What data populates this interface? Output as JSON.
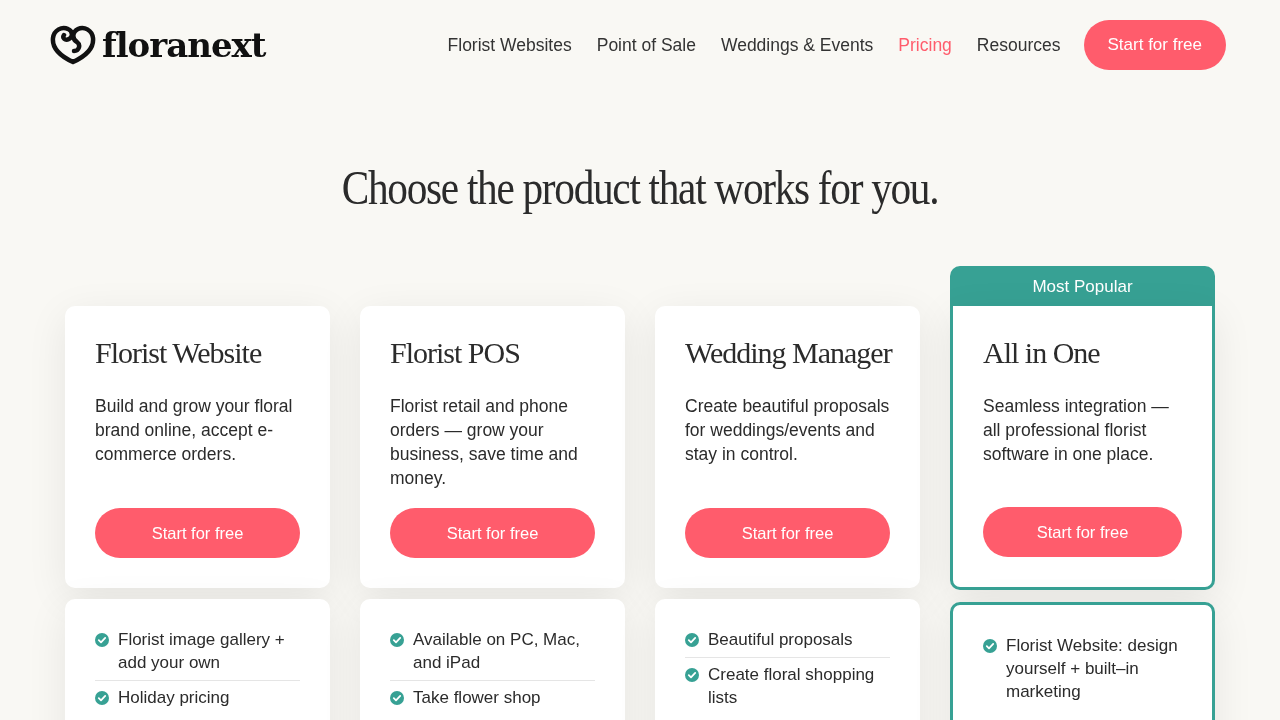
{
  "header": {
    "logo_text": "floranext",
    "nav": [
      {
        "label": "Florist Websites",
        "selected": false
      },
      {
        "label": "Point of Sale",
        "selected": false
      },
      {
        "label": "Weddings & Events",
        "selected": false
      },
      {
        "label": "Pricing",
        "selected": true
      },
      {
        "label": "Resources",
        "selected": false
      }
    ],
    "cta": "Start for free"
  },
  "heading": "Choose the product that works for you.",
  "products": [
    {
      "name": "Florist Website",
      "featured": false,
      "description": "Build and grow your floral brand online, accept e-commerce orders.",
      "button": "Start for free",
      "features": [
        "Florist image gallery + add your own",
        "Holiday pricing"
      ]
    },
    {
      "name": "Florist POS",
      "featured": false,
      "description": "Florist retail and phone orders — grow your business, save time and money.",
      "button": "Start for free",
      "features": [
        "Available on PC, Mac, and iPad",
        "Take flower shop"
      ]
    },
    {
      "name": "Wedding Manager",
      "featured": false,
      "description": "Create beautiful proposals for weddings/events and stay in control.",
      "button": "Start for free",
      "features": [
        "Beautiful proposals",
        "Create floral shopping lists"
      ]
    },
    {
      "name": "All in One",
      "featured": true,
      "badge": "Most Popular",
      "description": "Seamless integration — all professional florist software in one place.",
      "button": "Start for free",
      "features": [
        "Florist Website: design yourself + built–in marketing"
      ]
    }
  ]
}
